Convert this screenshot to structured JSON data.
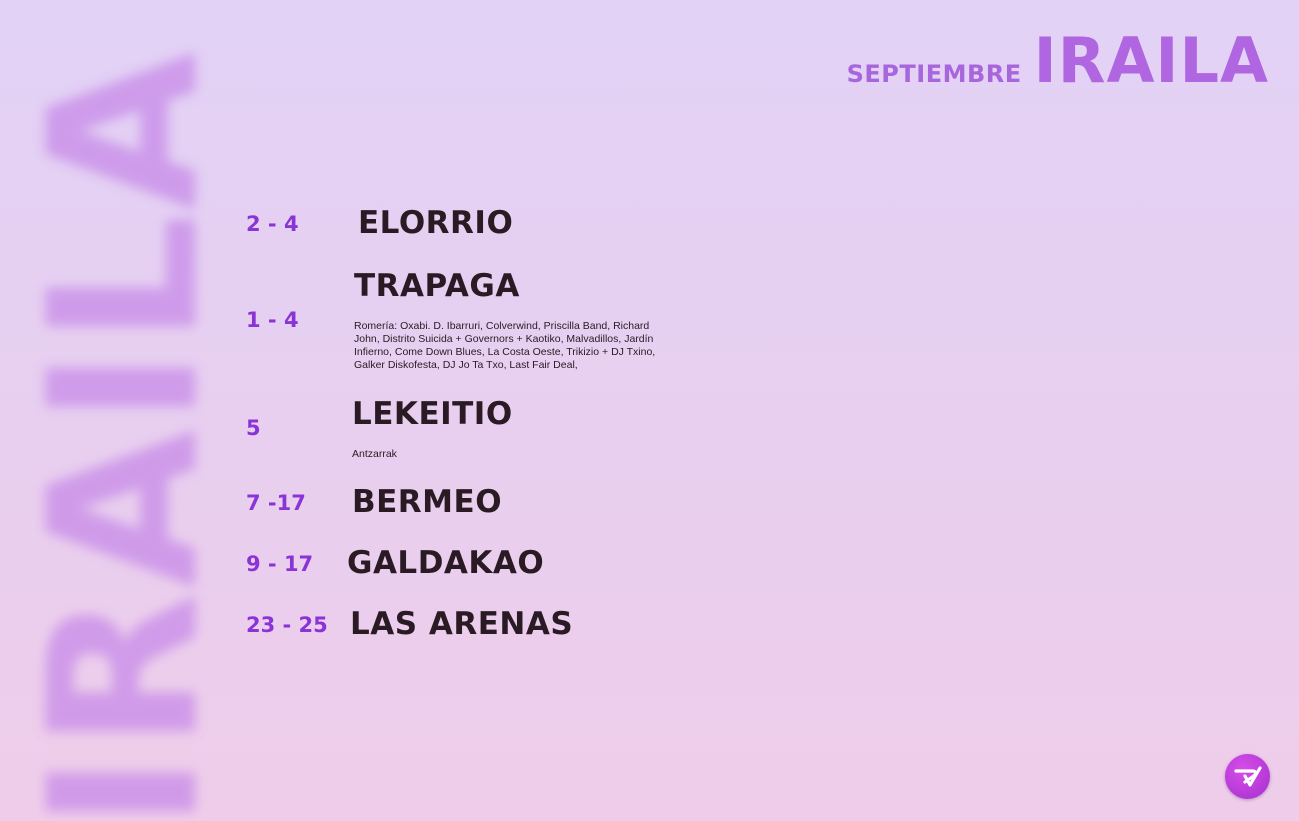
{
  "background_word": "IRAILA",
  "header": {
    "subtitle": "SEPTIEMBRE",
    "title": "IRAILA"
  },
  "events": [
    {
      "dates": "2 - 4",
      "town": "ELORRIO",
      "details": ""
    },
    {
      "dates": "1 - 4",
      "town": "TRAPAGA",
      "details": "Romería: Oxabi. D. Ibarruri, Colverwind, Priscilla Band, Richard John, Distrito Suicida + Governors + Kaotiko, Malvadillos, Jardín Infierno, Come Down Blues, La Costa Oeste,  Trikizio + DJ Txino, Galker Diskofesta, DJ Jo Ta Txo, Last Fair Deal,"
    },
    {
      "dates": "5",
      "town": "LEKEITIO",
      "details": "Antzarrak"
    },
    {
      "dates": "7 -17",
      "town": "BERMEO",
      "details": ""
    },
    {
      "dates": "9 - 17",
      "town": "GALDAKAO",
      "details": ""
    },
    {
      "dates": "23 - 25",
      "town": "LAS ARENAS",
      "details": ""
    }
  ],
  "colors": {
    "accent": "#8a34d8",
    "title": "#b066e0",
    "text": "#2a1a24",
    "logo": "#c040e0"
  },
  "logo_icon": "brand-logo-icon"
}
